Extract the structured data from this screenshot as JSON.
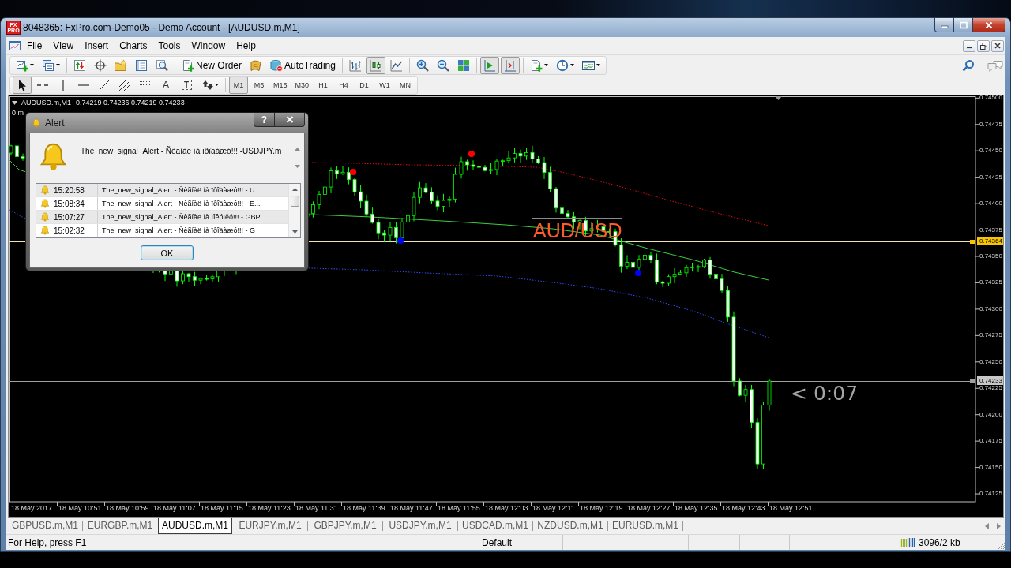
{
  "window": {
    "title": "8048365: FxPro.com-Demo05 - Demo Account - [AUDUSD.m,M1]",
    "logo": [
      "FX",
      "PRO"
    ]
  },
  "menu": [
    {
      "label": "File"
    },
    {
      "label": "View"
    },
    {
      "label": "Insert"
    },
    {
      "label": "Charts"
    },
    {
      "label": "Tools"
    },
    {
      "label": "Window"
    },
    {
      "label": "Help"
    }
  ],
  "toolbar": {
    "new_order": "New Order",
    "auto_trading": "AutoTrading",
    "chart_types": [
      {
        "kind": "bars",
        "selected": false
      },
      {
        "kind": "candles",
        "selected": true
      },
      {
        "kind": "line",
        "selected": false
      }
    ],
    "auto_scroll": {
      "on": true
    },
    "chart_shift": {
      "on": true
    }
  },
  "drawing_tools": [
    {
      "kind": "cursor",
      "selected": true
    },
    {
      "kind": "crosshair",
      "selected": false
    },
    {
      "kind": "vertical-line",
      "selected": false
    },
    {
      "kind": "horizontal-line",
      "selected": false
    },
    {
      "kind": "trendline",
      "selected": false
    },
    {
      "kind": "channel",
      "selected": false
    },
    {
      "kind": "grid",
      "selected": false
    },
    {
      "kind": "text",
      "glyph": "A",
      "selected": false
    },
    {
      "kind": "label",
      "glyph": "T",
      "selected": false
    },
    {
      "kind": "arrows",
      "selected": false
    }
  ],
  "periods": [
    {
      "label": "M1",
      "selected": true
    },
    {
      "label": "M5",
      "selected": false
    },
    {
      "label": "M15",
      "selected": false
    },
    {
      "label": "M30",
      "selected": false
    },
    {
      "label": "H1",
      "selected": false
    },
    {
      "label": "H4",
      "selected": false
    },
    {
      "label": "D1",
      "selected": false
    },
    {
      "label": "W1",
      "selected": false
    },
    {
      "label": "MN",
      "selected": false
    }
  ],
  "chart": {
    "symbol": "AUDUSD.m,M1",
    "ohlc": "0.74219 0.74236 0.74219 0.74233",
    "comment": "0 m",
    "text_object": "AUD/USD",
    "timer": "< 0:07",
    "price_axis": [
      "0.74500",
      "0.74475",
      "0.74450",
      "0.74425",
      "0.74400",
      "0.74375",
      "0.74350",
      "0.74325",
      "0.74300",
      "0.74275",
      "0.74250",
      "0.74225",
      "0.74200",
      "0.74175",
      "0.74150",
      "0.74125"
    ],
    "price_lines": [
      {
        "kind": "level",
        "label": "0.74364"
      },
      {
        "kind": "bid",
        "label": "0.74233"
      }
    ],
    "time_axis": [
      "18 May 2017",
      "18 May 10:51",
      "18 May 10:59",
      "18 May 11:07",
      "18 May 11:15",
      "18 May 11:23",
      "18 May 11:31",
      "18 May 11:39",
      "18 May 11:47",
      "18 May 11:55",
      "18 May 12:03",
      "18 May 12:11",
      "18 May 12:19",
      "18 May 12:27",
      "18 May 12:35",
      "18 May 12:43",
      "18 May 12:51"
    ],
    "signals": [
      {
        "color": "#ff0000"
      },
      {
        "color": "#0000ff"
      },
      {
        "color": "#ff0000"
      },
      {
        "color": "#0000ff"
      }
    ]
  },
  "alert_dialog": {
    "title": "Alert",
    "help": "?",
    "message": "The_new_signal_Alert - Ñèãíàë íà ïðîäàæó!!! -USDJPY.m",
    "history": [
      {
        "time": "15:20:58",
        "text": "The_new_signal_Alert - Ñèãíàë íà ïðîäàæó!!! - U..."
      },
      {
        "time": "15:08:34",
        "text": "The_new_signal_Alert - Ñèãíàë íà ïðîäàæó!!! - E..."
      },
      {
        "time": "15:07:27",
        "text": "The_new_signal_Alert - Ñèãíàë íà ïîêóïêó!!! - GBP..."
      },
      {
        "time": "15:02:32",
        "text": "The_new_signal_Alert - Ñèãíàë íà ïðîäàæó!!! - G"
      }
    ],
    "button": "OK"
  },
  "chart_tabs": [
    {
      "label": "GBPUSD.m,M1",
      "selected": false
    },
    {
      "label": "EURGBP.m,M1",
      "selected": false
    },
    {
      "label": "AUDUSD.m,M1",
      "selected": true
    },
    {
      "label": "EURJPY.m,M1",
      "selected": false
    },
    {
      "label": "GBPJPY.m,M1",
      "selected": false
    },
    {
      "label": "USDJPY.m,M1",
      "selected": false
    },
    {
      "label": "USDCAD.m,M1",
      "selected": false
    },
    {
      "label": "NZDUSD.m,M1",
      "selected": false
    },
    {
      "label": "EURUSD.m,M1",
      "selected": false
    }
  ],
  "status_bar": {
    "help": "For Help, press F1",
    "profile": "Default",
    "traffic": "3096/2 kb"
  }
}
